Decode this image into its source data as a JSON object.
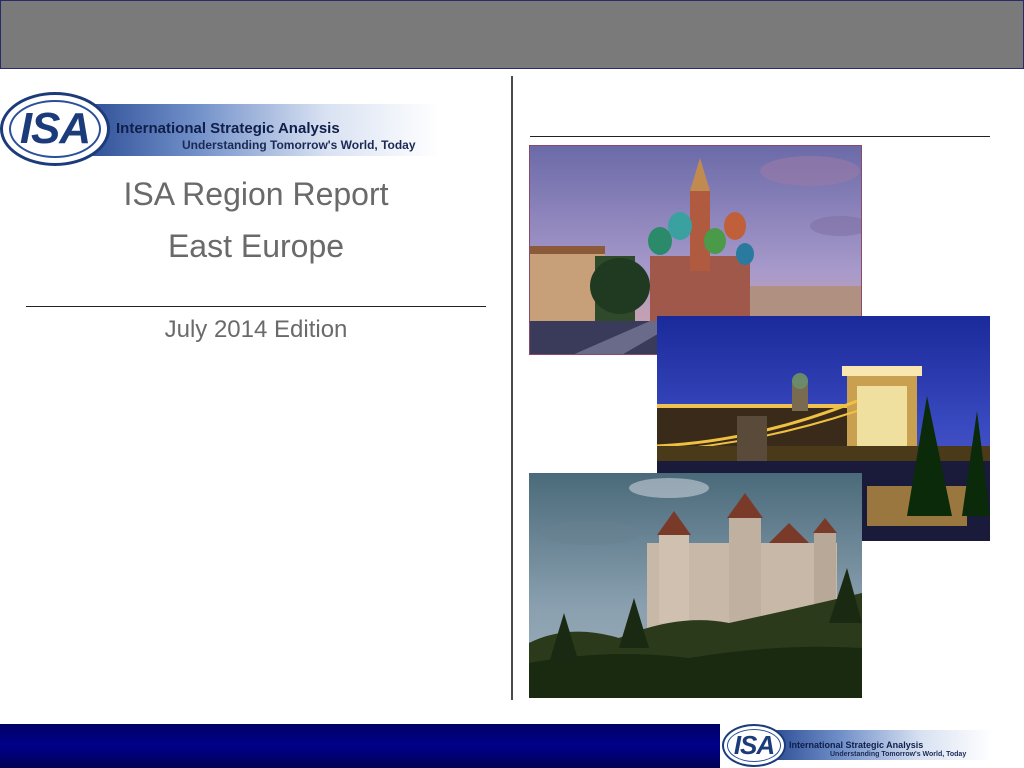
{
  "logo": {
    "emblem_text": "ISA",
    "name": "International Strategic Analysis",
    "tagline": "Understanding Tomorrow's World, Today"
  },
  "report": {
    "title": "ISA Region Report",
    "region": "East Europe",
    "edition": "July 2014 Edition"
  },
  "colors": {
    "top_bar": "#7a7a7a",
    "bottom_bar": "#00008a",
    "title_text": "#6a6a6a",
    "logo_navy": "#1b3b7a"
  }
}
